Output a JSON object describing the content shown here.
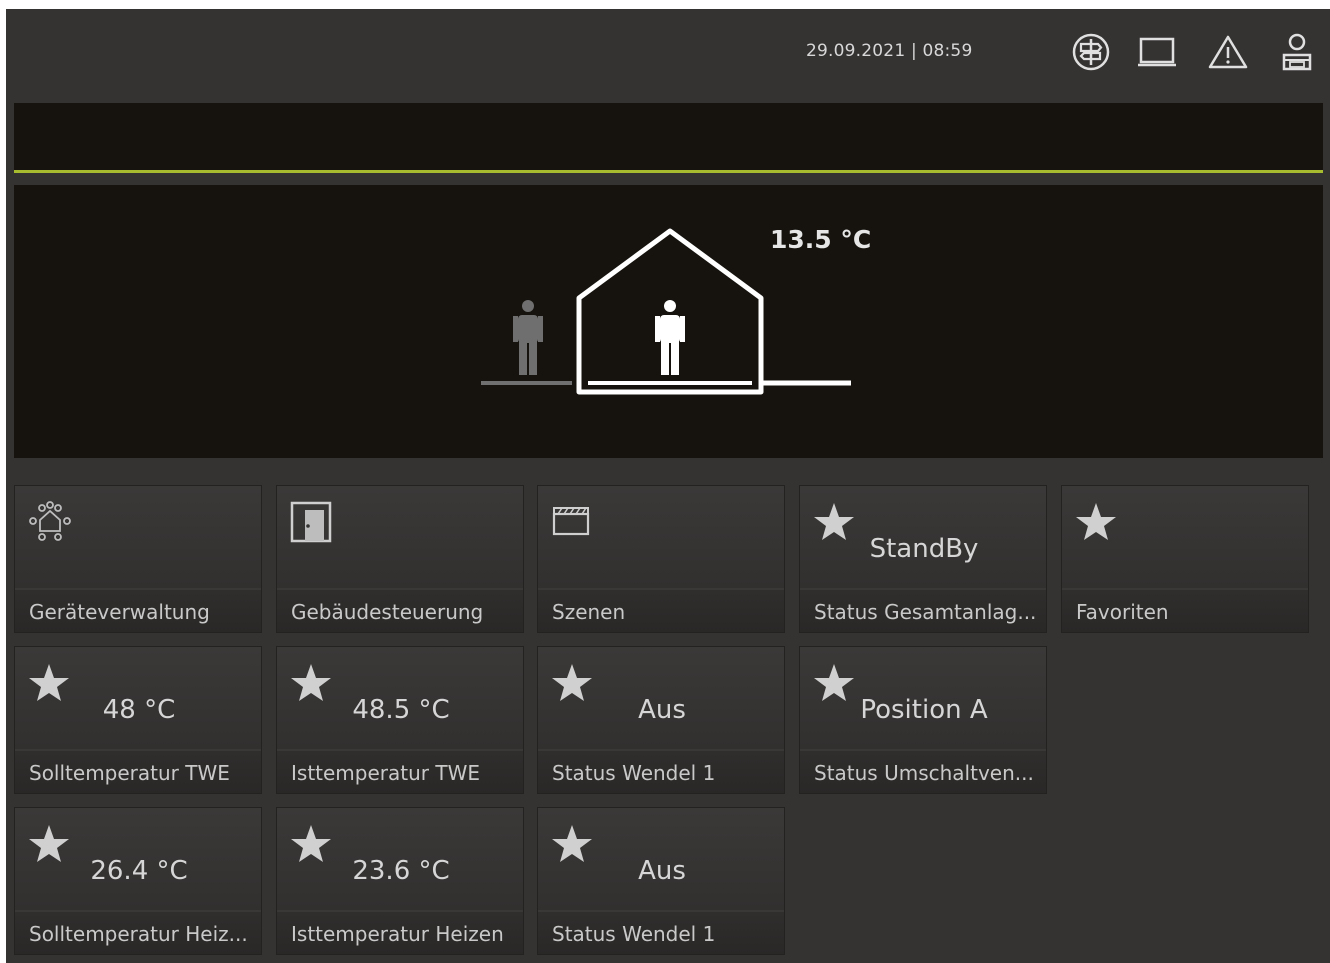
{
  "header": {
    "datetime": "29.09.2021 | 08:59",
    "icons": [
      "signpost-icon",
      "screen-icon",
      "warning-icon",
      "user-icon"
    ]
  },
  "scene": {
    "temperature": "13.5 °C"
  },
  "tiles": [
    {
      "label": "Geräteverwaltung",
      "value": "",
      "icon": "device-network-icon"
    },
    {
      "label": "Gebäudesteuerung",
      "value": "",
      "icon": "door-icon"
    },
    {
      "label": "Szenen",
      "value": "",
      "icon": "clapperboard-icon"
    },
    {
      "label": "Status Gesamtanlag...",
      "value": "StandBy",
      "icon": "star-icon"
    },
    {
      "label": "Favoriten",
      "value": "",
      "icon": "star-icon"
    },
    {
      "label": "Solltemperatur TWE",
      "value": "48 °C",
      "icon": "star-icon"
    },
    {
      "label": "Isttemperatur TWE",
      "value": "48.5 °C",
      "icon": "star-icon"
    },
    {
      "label": "Status Wendel 1",
      "value": "Aus",
      "icon": "star-icon"
    },
    {
      "label": "Status Umschaltven...",
      "value": "Position A",
      "icon": "star-icon"
    },
    {
      "label": "Solltemperatur Heiz...",
      "value": "26.4 °C",
      "icon": "star-icon"
    },
    {
      "label": "Isttemperatur Heizen",
      "value": "23.6 °C",
      "icon": "star-icon"
    },
    {
      "label": "Status Wendel 1",
      "value": "Aus",
      "icon": "star-icon"
    }
  ],
  "colors": {
    "background": "#353332",
    "panel": "#16130e",
    "accent": "#a7bd2f"
  }
}
